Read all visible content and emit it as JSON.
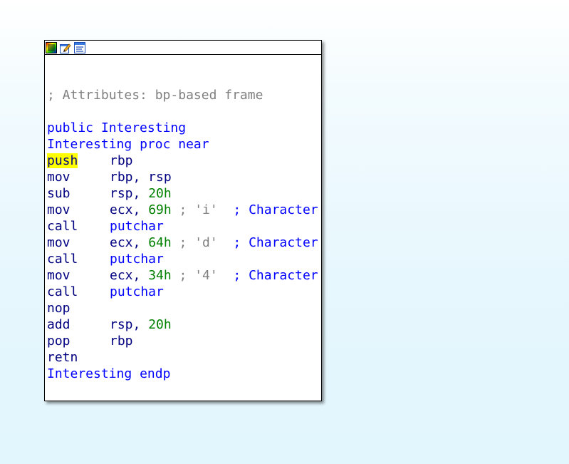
{
  "header": {
    "icons": [
      "graph-color-icon",
      "edit-node-icon",
      "switch-view-icon"
    ]
  },
  "code": {
    "attributes_comment": "; Attributes: bp-based frame",
    "public_kw": "public",
    "func_name": "Interesting",
    "proc_name": "Interesting",
    "proc_kw": "proc near",
    "endp_name": "Interesting",
    "endp_kw": "endp",
    "lines": [
      {
        "mnemonic": "push",
        "operand": "rbp"
      },
      {
        "mnemonic": "mov",
        "operand": "rbp, rsp"
      },
      {
        "mnemonic": "sub",
        "operand_reg": "rsp, ",
        "operand_num": "20h"
      },
      {
        "mnemonic": "mov",
        "operand_reg": "ecx, ",
        "operand_num": "69h",
        "comment": " ; 'i'",
        "comment2": "  ; Character"
      },
      {
        "mnemonic": "call",
        "operand": "putchar"
      },
      {
        "mnemonic": "mov",
        "operand_reg": "ecx, ",
        "operand_num": "64h",
        "comment": " ; 'd'",
        "comment2": "  ; Character"
      },
      {
        "mnemonic": "call",
        "operand": "putchar"
      },
      {
        "mnemonic": "mov",
        "operand_reg": "ecx, ",
        "operand_num": "34h",
        "comment": " ; '4'",
        "comment2": "  ; Character"
      },
      {
        "mnemonic": "call",
        "operand": "putchar"
      },
      {
        "mnemonic": "nop"
      },
      {
        "mnemonic": "add",
        "operand_reg": "rsp, ",
        "operand_num": "20h"
      },
      {
        "mnemonic": "pop",
        "operand": "rbp"
      },
      {
        "mnemonic": "retn"
      }
    ]
  },
  "colors": {
    "keyword": "#0000ff",
    "mnemonic": "#000080",
    "number": "#008000",
    "comment": "#808080",
    "highlight": "#ffff00"
  }
}
